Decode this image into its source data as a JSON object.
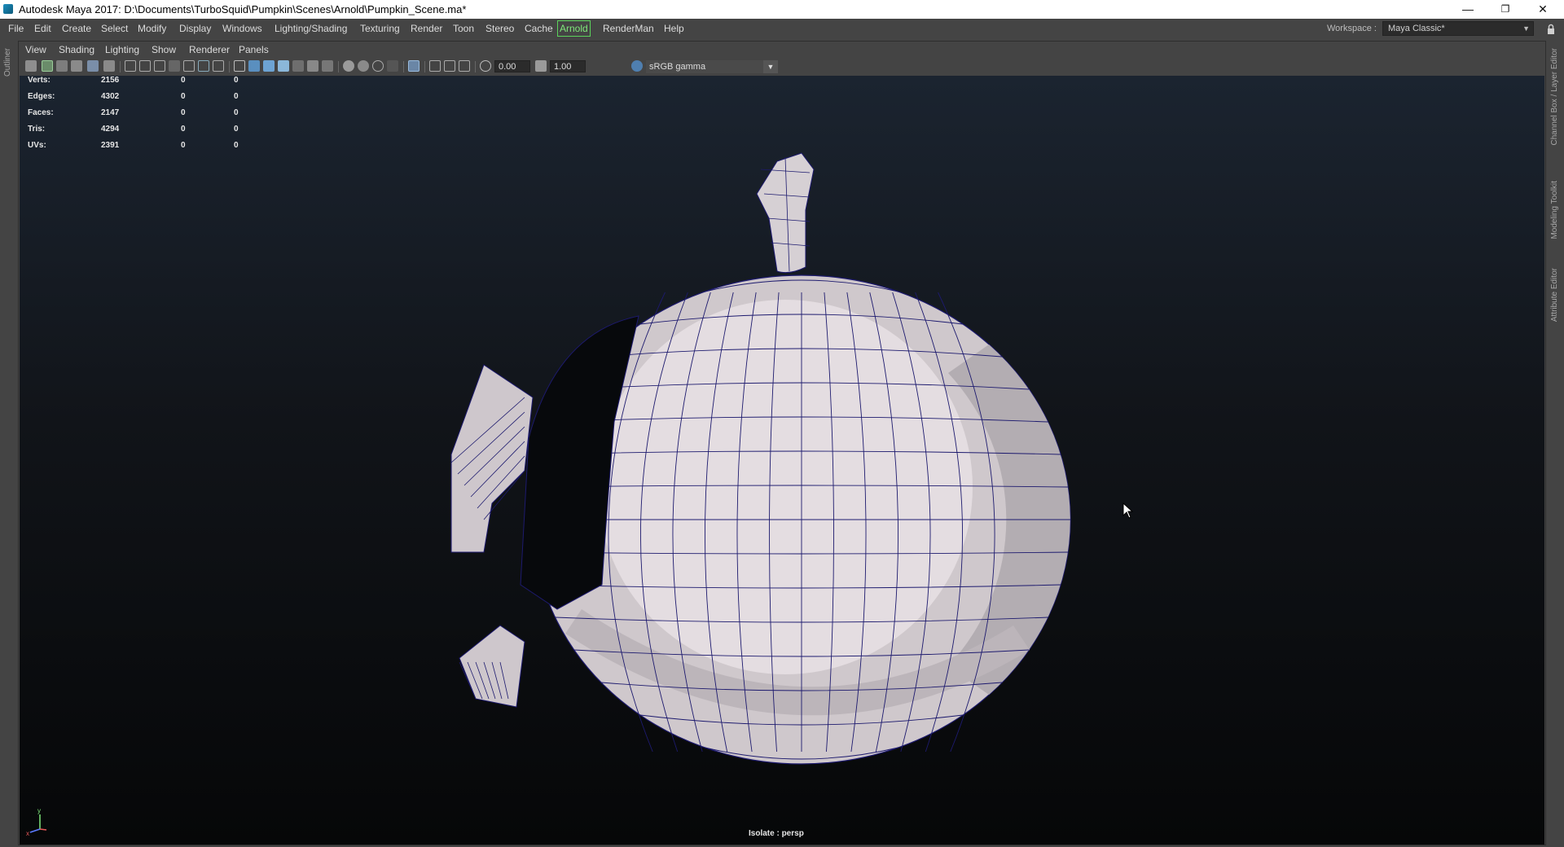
{
  "window": {
    "title": "Autodesk Maya 2017: D:\\Documents\\TurboSquid\\Pumpkin\\Scenes\\Arnold\\Pumpkin_Scene.ma*",
    "minimize": "—",
    "restore": "❐",
    "close": "✕"
  },
  "menubar": {
    "items": [
      "File",
      "Edit",
      "Create",
      "Select",
      "Modify",
      "Display",
      "Windows",
      "Lighting/Shading",
      "Texturing",
      "Render",
      "Toon",
      "Stereo",
      "Cache",
      "Arnold",
      "RenderMan",
      "Help"
    ],
    "workspace_label": "Workspace :",
    "workspace_value": "Maya Classic*"
  },
  "left_tabs": {
    "outliner": "Outliner"
  },
  "right_tabs": {
    "channel_box": "Channel Box / Layer Editor",
    "modeling_toolkit": "Modeling Toolkit",
    "attribute_editor": "Attribute Editor"
  },
  "panel_menu": [
    "View",
    "Shading",
    "Lighting",
    "Show",
    "Renderer",
    "Panels"
  ],
  "toolbar": {
    "exposure": "0.00",
    "gamma": "1.00",
    "color_space": "sRGB gamma"
  },
  "hud": {
    "rows": [
      {
        "label": "Verts:",
        "total": "2156",
        "sel1": "0",
        "sel2": "0"
      },
      {
        "label": "Edges:",
        "total": "4302",
        "sel1": "0",
        "sel2": "0"
      },
      {
        "label": "Faces:",
        "total": "2147",
        "sel1": "0",
        "sel2": "0"
      },
      {
        "label": "Tris:",
        "total": "4294",
        "sel1": "0",
        "sel2": "0"
      },
      {
        "label": "UVs:",
        "total": "2391",
        "sel1": "0",
        "sel2": "0"
      }
    ],
    "isolate": "Isolate : persp",
    "axis_y": "y",
    "axis_x": "x"
  },
  "colors": {
    "accent_arnold": "#7fe77a",
    "mesh_wire": "#1d1a6e",
    "mesh_face": "#d9d3d6"
  }
}
